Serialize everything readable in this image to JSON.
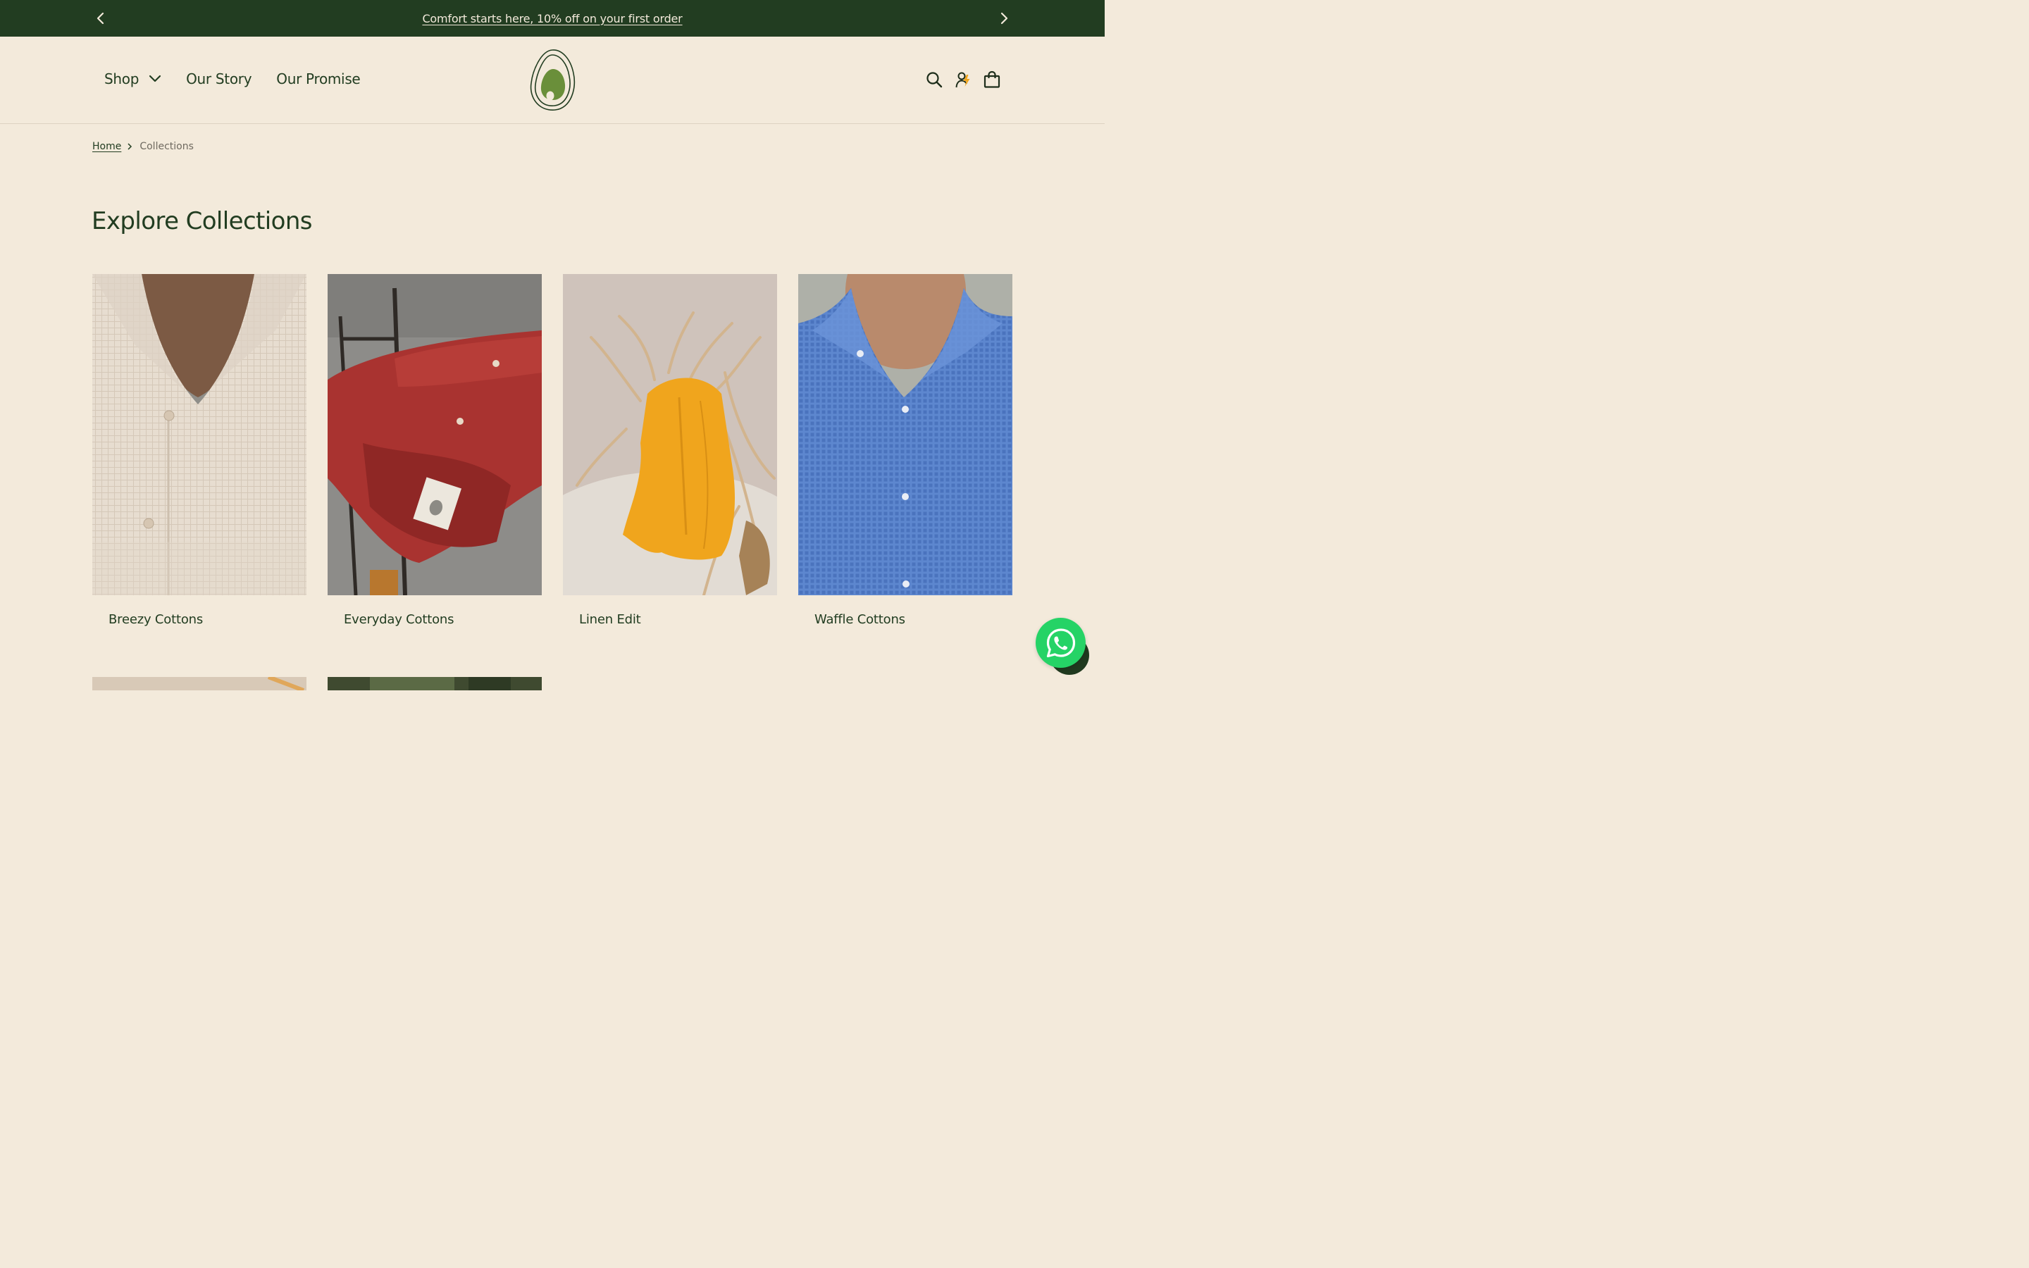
{
  "announcement": {
    "text": "Comfort starts here, 10% off on your first order",
    "prev_icon": "chevron-left-icon",
    "next_icon": "chevron-right-icon"
  },
  "nav": {
    "shop": "Shop",
    "our_story": "Our Story",
    "our_promise": "Our Promise"
  },
  "header_icons": [
    "search-icon",
    "account-icon",
    "cart-bag-icon"
  ],
  "breadcrumb": {
    "home": "Home",
    "current": "Collections"
  },
  "page_title": "Explore Collections",
  "collections": [
    {
      "label": "Breezy Cottons",
      "color": "#e6dccf"
    },
    {
      "label": "Everyday Cottons",
      "color": "#a93330"
    },
    {
      "label": "Linen Edit",
      "color": "#f0a51d"
    },
    {
      "label": "Waffle Cottons",
      "color": "#5d87cf"
    }
  ],
  "colors": {
    "brand_green": "#223d21",
    "background": "#f3eadb",
    "whatsapp": "#25d366",
    "logo_leaf": "#6a8f3a"
  }
}
